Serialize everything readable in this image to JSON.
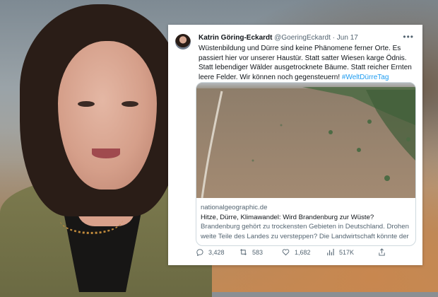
{
  "tweet": {
    "author_name": "Katrin Göring-Eckardt",
    "handle": "@GoeringEckardt",
    "separator": "·",
    "date": "Jun 17",
    "more_icon": "more-icon",
    "text": "Wüstenbildung und Dürre sind keine Phänomene ferner Orte. Es passiert hier vor unserer Haustür. Statt satter Wiesen karge Ödnis. Statt lebendiger Wälder ausgetrocknete Bäume. Statt reicher Ernten leere Felder. Wir können noch gegensteuern! ",
    "hashtag": "#WeltDürreTag",
    "card": {
      "domain": "nationalgeographic.de",
      "title": "Hitze, Dürre, Klimawandel: Wird Brandenburg zur Wüste?",
      "description": "Brandenburg gehört zu trockensten Gebieten in Deutschland. Drohen weite Teile des Landes zu versteppen? Die Landwirtschaft könnte der ..."
    },
    "actions": {
      "replies": "3,428",
      "retweets": "583",
      "likes": "1,682",
      "views": "517K"
    }
  },
  "colors": {
    "link": "#1d9bf0",
    "muted": "#536471",
    "text": "#0f1419",
    "border": "#cfd9de"
  }
}
